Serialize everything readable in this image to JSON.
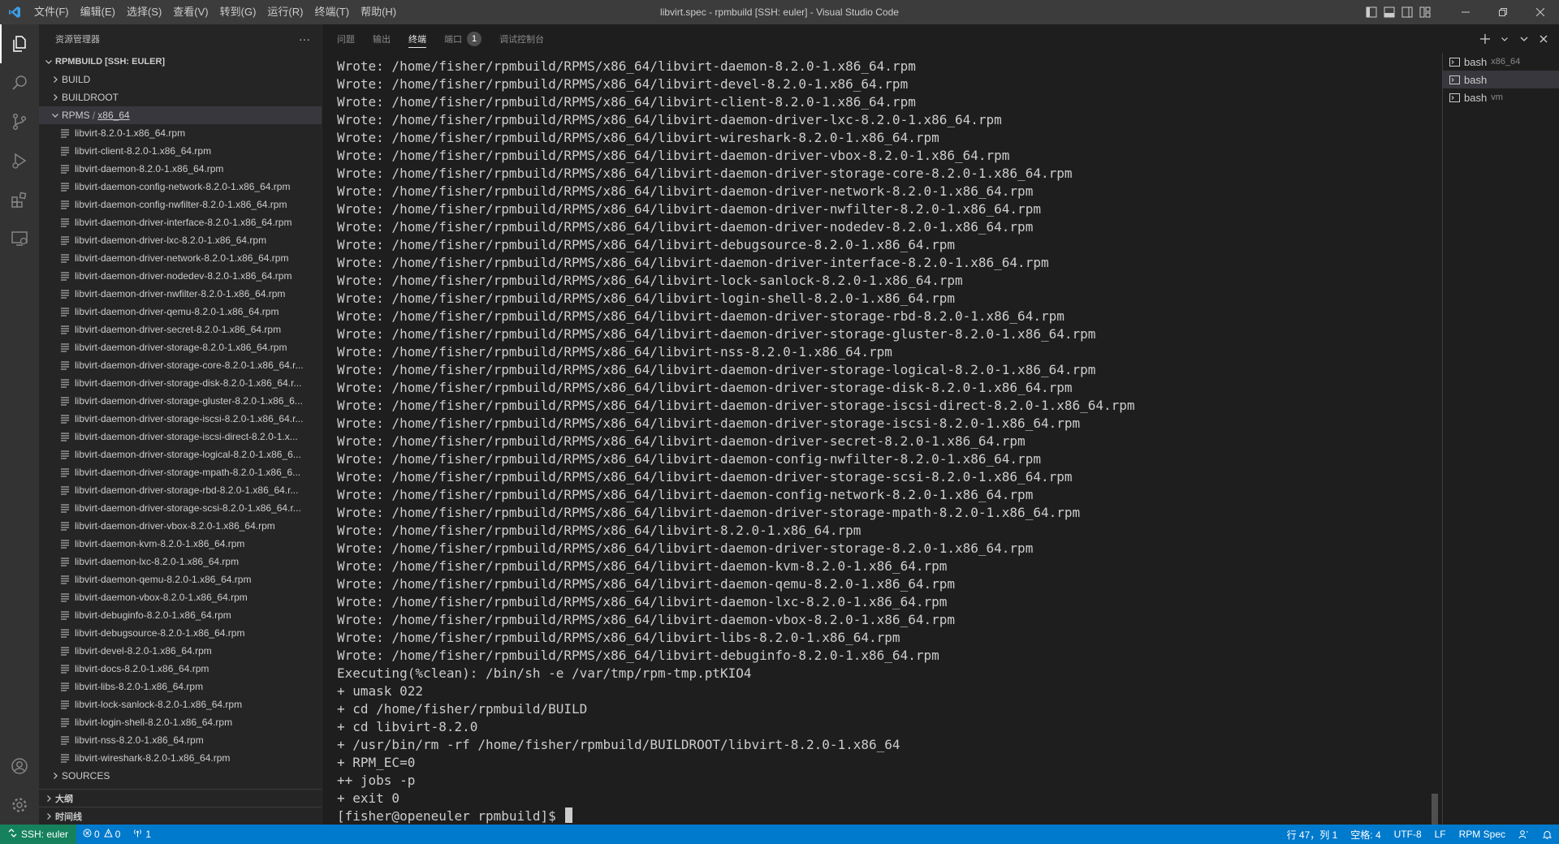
{
  "titlebar": {
    "title": "libvirt.spec - rpmbuild [SSH: euler] - Visual Studio Code",
    "menu": [
      "文件(F)",
      "编辑(E)",
      "选择(S)",
      "查看(V)",
      "转到(G)",
      "运行(R)",
      "终端(T)",
      "帮助(H)"
    ]
  },
  "explorer": {
    "header": "资源管理器",
    "root": "RPMBUILD [SSH: EULER]",
    "folders": {
      "build": "BUILD",
      "buildroot": "BUILDROOT",
      "rpms": "RPMS",
      "rpms_sub": "x86_64",
      "sources": "SOURCES"
    },
    "files": [
      "libvirt-8.2.0-1.x86_64.rpm",
      "libvirt-client-8.2.0-1.x86_64.rpm",
      "libvirt-daemon-8.2.0-1.x86_64.rpm",
      "libvirt-daemon-config-network-8.2.0-1.x86_64.rpm",
      "libvirt-daemon-config-nwfilter-8.2.0-1.x86_64.rpm",
      "libvirt-daemon-driver-interface-8.2.0-1.x86_64.rpm",
      "libvirt-daemon-driver-lxc-8.2.0-1.x86_64.rpm",
      "libvirt-daemon-driver-network-8.2.0-1.x86_64.rpm",
      "libvirt-daemon-driver-nodedev-8.2.0-1.x86_64.rpm",
      "libvirt-daemon-driver-nwfilter-8.2.0-1.x86_64.rpm",
      "libvirt-daemon-driver-qemu-8.2.0-1.x86_64.rpm",
      "libvirt-daemon-driver-secret-8.2.0-1.x86_64.rpm",
      "libvirt-daemon-driver-storage-8.2.0-1.x86_64.rpm",
      "libvirt-daemon-driver-storage-core-8.2.0-1.x86_64.r...",
      "libvirt-daemon-driver-storage-disk-8.2.0-1.x86_64.r...",
      "libvirt-daemon-driver-storage-gluster-8.2.0-1.x86_6...",
      "libvirt-daemon-driver-storage-iscsi-8.2.0-1.x86_64.r...",
      "libvirt-daemon-driver-storage-iscsi-direct-8.2.0-1.x...",
      "libvirt-daemon-driver-storage-logical-8.2.0-1.x86_6...",
      "libvirt-daemon-driver-storage-mpath-8.2.0-1.x86_6...",
      "libvirt-daemon-driver-storage-rbd-8.2.0-1.x86_64.r...",
      "libvirt-daemon-driver-storage-scsi-8.2.0-1.x86_64.r...",
      "libvirt-daemon-driver-vbox-8.2.0-1.x86_64.rpm",
      "libvirt-daemon-kvm-8.2.0-1.x86_64.rpm",
      "libvirt-daemon-lxc-8.2.0-1.x86_64.rpm",
      "libvirt-daemon-qemu-8.2.0-1.x86_64.rpm",
      "libvirt-daemon-vbox-8.2.0-1.x86_64.rpm",
      "libvirt-debuginfo-8.2.0-1.x86_64.rpm",
      "libvirt-debugsource-8.2.0-1.x86_64.rpm",
      "libvirt-devel-8.2.0-1.x86_64.rpm",
      "libvirt-docs-8.2.0-1.x86_64.rpm",
      "libvirt-libs-8.2.0-1.x86_64.rpm",
      "libvirt-lock-sanlock-8.2.0-1.x86_64.rpm",
      "libvirt-login-shell-8.2.0-1.x86_64.rpm",
      "libvirt-nss-8.2.0-1.x86_64.rpm",
      "libvirt-wireshark-8.2.0-1.x86_64.rpm"
    ],
    "outline": "大纲",
    "timeline": "时间线"
  },
  "panel": {
    "tabs": {
      "problems": "问题",
      "output": "输出",
      "terminal": "终端",
      "ports": "端口",
      "ports_badge": "1",
      "debug_console": "调试控制台"
    },
    "terminals": [
      {
        "name": "bash",
        "desc": "x86_64"
      },
      {
        "name": "bash",
        "desc": ""
      },
      {
        "name": "bash",
        "desc": "vm"
      }
    ],
    "terminal_lines": [
      "Wrote: /home/fisher/rpmbuild/RPMS/x86_64/libvirt-daemon-8.2.0-1.x86_64.rpm",
      "Wrote: /home/fisher/rpmbuild/RPMS/x86_64/libvirt-devel-8.2.0-1.x86_64.rpm",
      "Wrote: /home/fisher/rpmbuild/RPMS/x86_64/libvirt-client-8.2.0-1.x86_64.rpm",
      "Wrote: /home/fisher/rpmbuild/RPMS/x86_64/libvirt-daemon-driver-lxc-8.2.0-1.x86_64.rpm",
      "Wrote: /home/fisher/rpmbuild/RPMS/x86_64/libvirt-wireshark-8.2.0-1.x86_64.rpm",
      "Wrote: /home/fisher/rpmbuild/RPMS/x86_64/libvirt-daemon-driver-vbox-8.2.0-1.x86_64.rpm",
      "Wrote: /home/fisher/rpmbuild/RPMS/x86_64/libvirt-daemon-driver-storage-core-8.2.0-1.x86_64.rpm",
      "Wrote: /home/fisher/rpmbuild/RPMS/x86_64/libvirt-daemon-driver-network-8.2.0-1.x86_64.rpm",
      "Wrote: /home/fisher/rpmbuild/RPMS/x86_64/libvirt-daemon-driver-nwfilter-8.2.0-1.x86_64.rpm",
      "Wrote: /home/fisher/rpmbuild/RPMS/x86_64/libvirt-daemon-driver-nodedev-8.2.0-1.x86_64.rpm",
      "Wrote: /home/fisher/rpmbuild/RPMS/x86_64/libvirt-debugsource-8.2.0-1.x86_64.rpm",
      "Wrote: /home/fisher/rpmbuild/RPMS/x86_64/libvirt-daemon-driver-interface-8.2.0-1.x86_64.rpm",
      "Wrote: /home/fisher/rpmbuild/RPMS/x86_64/libvirt-lock-sanlock-8.2.0-1.x86_64.rpm",
      "Wrote: /home/fisher/rpmbuild/RPMS/x86_64/libvirt-login-shell-8.2.0-1.x86_64.rpm",
      "Wrote: /home/fisher/rpmbuild/RPMS/x86_64/libvirt-daemon-driver-storage-rbd-8.2.0-1.x86_64.rpm",
      "Wrote: /home/fisher/rpmbuild/RPMS/x86_64/libvirt-daemon-driver-storage-gluster-8.2.0-1.x86_64.rpm",
      "Wrote: /home/fisher/rpmbuild/RPMS/x86_64/libvirt-nss-8.2.0-1.x86_64.rpm",
      "Wrote: /home/fisher/rpmbuild/RPMS/x86_64/libvirt-daemon-driver-storage-logical-8.2.0-1.x86_64.rpm",
      "Wrote: /home/fisher/rpmbuild/RPMS/x86_64/libvirt-daemon-driver-storage-disk-8.2.0-1.x86_64.rpm",
      "Wrote: /home/fisher/rpmbuild/RPMS/x86_64/libvirt-daemon-driver-storage-iscsi-direct-8.2.0-1.x86_64.rpm",
      "Wrote: /home/fisher/rpmbuild/RPMS/x86_64/libvirt-daemon-driver-storage-iscsi-8.2.0-1.x86_64.rpm",
      "Wrote: /home/fisher/rpmbuild/RPMS/x86_64/libvirt-daemon-driver-secret-8.2.0-1.x86_64.rpm",
      "Wrote: /home/fisher/rpmbuild/RPMS/x86_64/libvirt-daemon-config-nwfilter-8.2.0-1.x86_64.rpm",
      "Wrote: /home/fisher/rpmbuild/RPMS/x86_64/libvirt-daemon-driver-storage-scsi-8.2.0-1.x86_64.rpm",
      "Wrote: /home/fisher/rpmbuild/RPMS/x86_64/libvirt-daemon-config-network-8.2.0-1.x86_64.rpm",
      "Wrote: /home/fisher/rpmbuild/RPMS/x86_64/libvirt-daemon-driver-storage-mpath-8.2.0-1.x86_64.rpm",
      "Wrote: /home/fisher/rpmbuild/RPMS/x86_64/libvirt-8.2.0-1.x86_64.rpm",
      "Wrote: /home/fisher/rpmbuild/RPMS/x86_64/libvirt-daemon-driver-storage-8.2.0-1.x86_64.rpm",
      "Wrote: /home/fisher/rpmbuild/RPMS/x86_64/libvirt-daemon-kvm-8.2.0-1.x86_64.rpm",
      "Wrote: /home/fisher/rpmbuild/RPMS/x86_64/libvirt-daemon-qemu-8.2.0-1.x86_64.rpm",
      "Wrote: /home/fisher/rpmbuild/RPMS/x86_64/libvirt-daemon-lxc-8.2.0-1.x86_64.rpm",
      "Wrote: /home/fisher/rpmbuild/RPMS/x86_64/libvirt-daemon-vbox-8.2.0-1.x86_64.rpm",
      "Wrote: /home/fisher/rpmbuild/RPMS/x86_64/libvirt-libs-8.2.0-1.x86_64.rpm",
      "Wrote: /home/fisher/rpmbuild/RPMS/x86_64/libvirt-debuginfo-8.2.0-1.x86_64.rpm",
      "Executing(%clean): /bin/sh -e /var/tmp/rpm-tmp.ptKIO4",
      "+ umask 022",
      "+ cd /home/fisher/rpmbuild/BUILD",
      "+ cd libvirt-8.2.0",
      "+ /usr/bin/rm -rf /home/fisher/rpmbuild/BUILDROOT/libvirt-8.2.0-1.x86_64",
      "+ RPM_EC=0",
      "++ jobs -p",
      "+ exit 0"
    ],
    "prompt": "[fisher@openeuler rpmbuild]$ "
  },
  "statusbar": {
    "remote": "SSH: euler",
    "errors": "0",
    "warnings": "0",
    "ports": "1",
    "position": "行 47，列 1",
    "spaces": "空格: 4",
    "encoding": "UTF-8",
    "eol": "LF",
    "language": "RPM Spec"
  },
  "colors": {
    "statusbar": "#007acc",
    "remote": "#16825d",
    "vscode_blue": "#3c9ee8"
  }
}
